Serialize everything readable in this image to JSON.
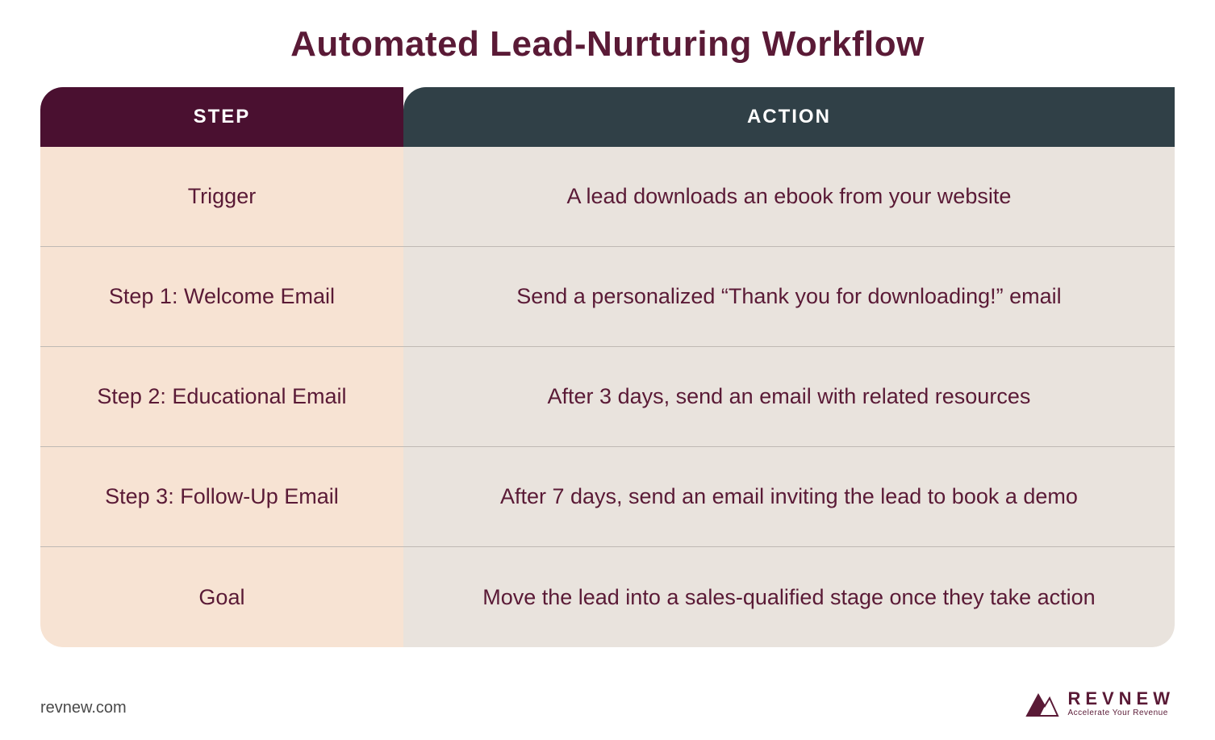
{
  "title": "Automated Lead-Nurturing Workflow",
  "headers": {
    "step": "STEP",
    "action": "ACTION"
  },
  "rows": [
    {
      "step": "Trigger",
      "action": "A lead downloads an ebook from your website"
    },
    {
      "step": "Step 1: Welcome Email",
      "action": "Send a personalized “Thank you for downloading!” email"
    },
    {
      "step": "Step 2: Educational Email",
      "action": "After 3 days, send an email with related resources"
    },
    {
      "step": "Step 3: Follow-Up Email",
      "action": "After 7 days, send an email inviting the lead to book a demo"
    },
    {
      "step": "Goal",
      "action": "Move the lead into a sales-qualified stage once they take action"
    }
  ],
  "footer": {
    "url": "revnew.com",
    "brand": "REVNEW",
    "tagline": "Accelerate Your Revenue"
  }
}
